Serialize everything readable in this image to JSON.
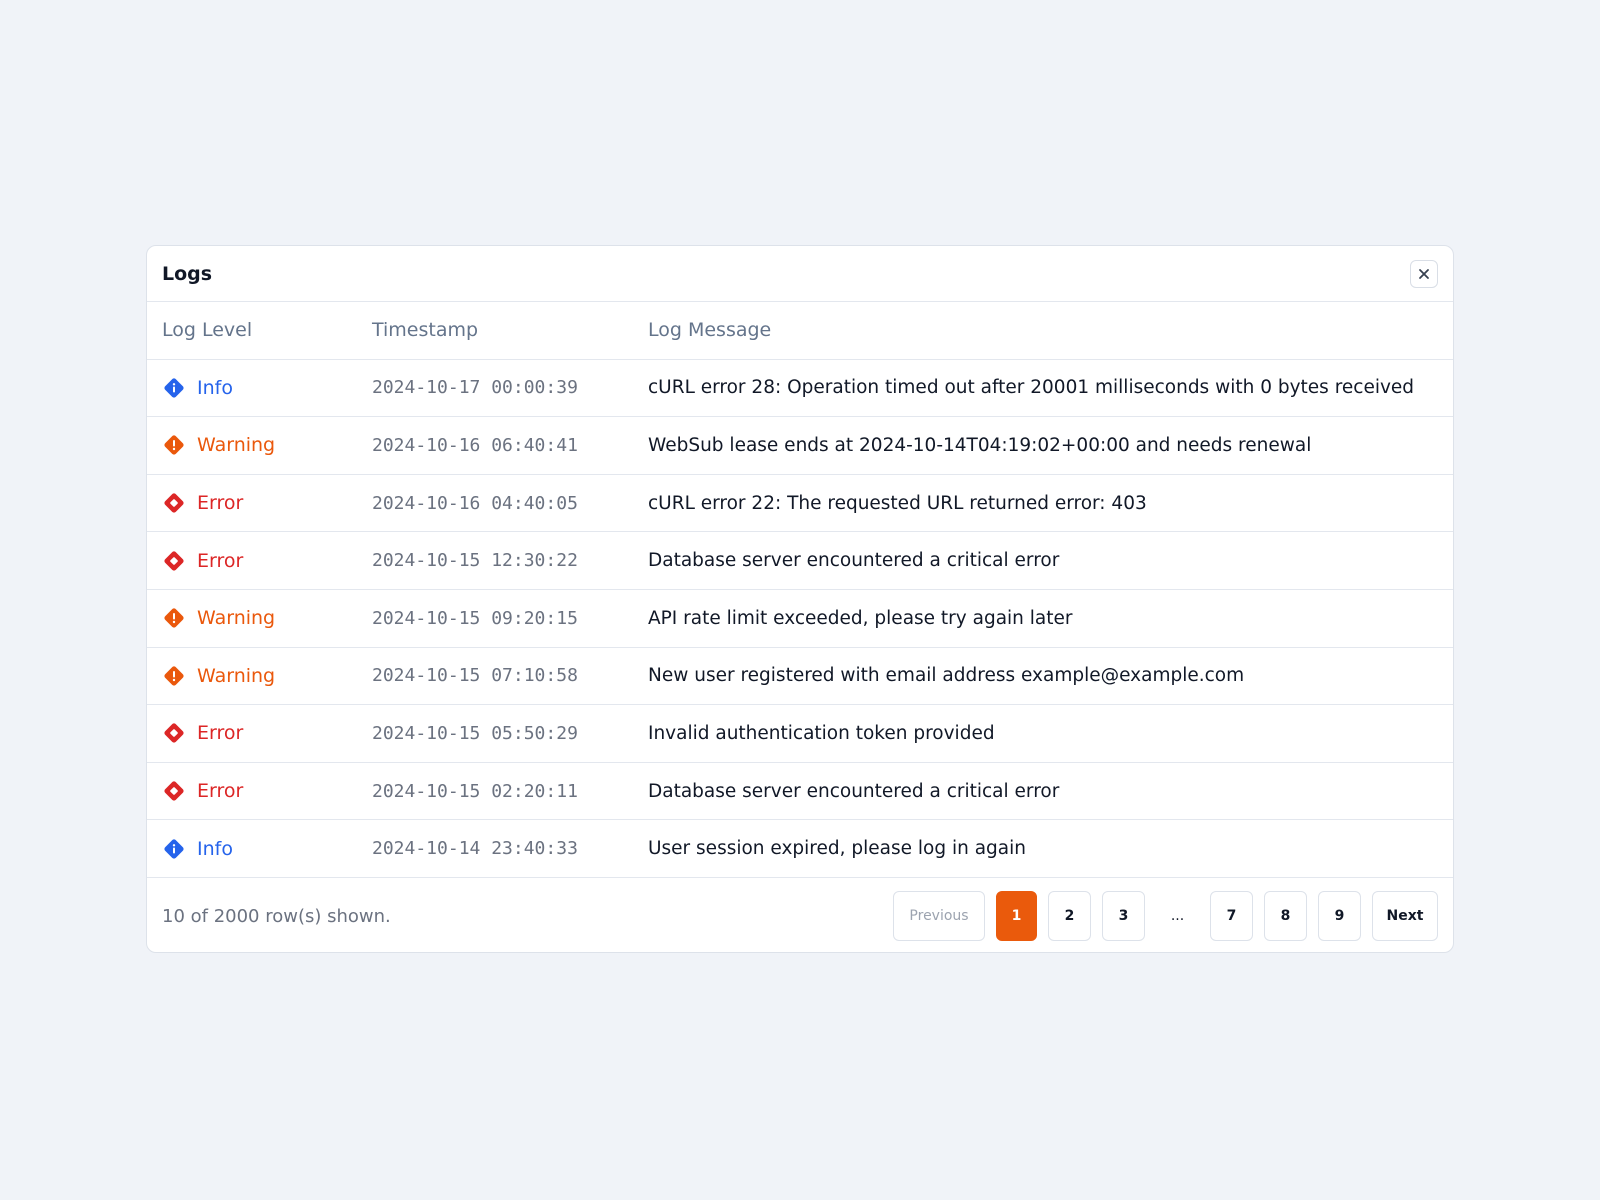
{
  "panel": {
    "title": "Logs",
    "close_icon": "x-icon"
  },
  "table": {
    "columns": [
      "Log Level",
      "Timestamp",
      "Log Message"
    ],
    "rows": [
      {
        "level": "Info",
        "timestamp": "2024-10-17 00:00:39",
        "message": "cURL error 28: Operation timed out after 20001 milliseconds with 0 bytes received"
      },
      {
        "level": "Warning",
        "timestamp": "2024-10-16 06:40:41",
        "message": "WebSub lease ends at 2024-10-14T04:19:02+00:00 and needs renewal"
      },
      {
        "level": "Error",
        "timestamp": "2024-10-16 04:40:05",
        "message": "cURL error 22: The requested URL returned error: 403"
      },
      {
        "level": "Error",
        "timestamp": "2024-10-15 12:30:22",
        "message": "Database server encountered a critical error"
      },
      {
        "level": "Warning",
        "timestamp": "2024-10-15 09:20:15",
        "message": "API rate limit exceeded, please try again later"
      },
      {
        "level": "Warning",
        "timestamp": "2024-10-15 07:10:58",
        "message": "New user registered with email address example@example.com"
      },
      {
        "level": "Error",
        "timestamp": "2024-10-15 05:50:29",
        "message": "Invalid authentication token provided"
      },
      {
        "level": "Error",
        "timestamp": "2024-10-15 02:20:11",
        "message": "Database server encountered a critical error"
      },
      {
        "level": "Info",
        "timestamp": "2024-10-14 23:40:33",
        "message": "User session expired, please log in again"
      }
    ]
  },
  "level_colors": {
    "Info": "#2563eb",
    "Warning": "#ea580c",
    "Error": "#dc2626"
  },
  "level_icons": {
    "Info": "info-icon",
    "Warning": "warning-icon",
    "Error": "error-icon"
  },
  "footer": {
    "rows_shown": "10 of 2000 row(s) shown."
  },
  "pagination": {
    "previous_label": "Previous",
    "next_label": "Next",
    "pages": [
      "1",
      "2",
      "3",
      "...",
      "7",
      "8",
      "9"
    ],
    "current": "1",
    "accent": "#ea5a0c"
  }
}
